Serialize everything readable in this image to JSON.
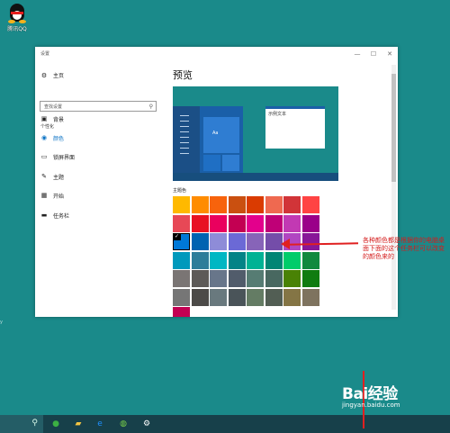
{
  "desktop": {
    "icon_label": "腾讯QQ",
    "edge_text": "y"
  },
  "window": {
    "title": "设置",
    "controls": {
      "minimize": "—",
      "maximize": "☐",
      "close": "✕"
    }
  },
  "sidebar": {
    "home": "主页",
    "search_placeholder": "查找设置",
    "section": "个性化",
    "items": [
      {
        "label": "背景",
        "icon": "picture-icon",
        "glyph": "▣"
      },
      {
        "label": "颜色",
        "icon": "palette-icon",
        "glyph": "◉",
        "active": true
      },
      {
        "label": "锁屏界面",
        "icon": "lock-screen-icon",
        "glyph": "▭"
      },
      {
        "label": "主题",
        "icon": "brush-icon",
        "glyph": "✎"
      },
      {
        "label": "开始",
        "icon": "start-icon",
        "glyph": "▦"
      },
      {
        "label": "任务栏",
        "icon": "taskbar-icon",
        "glyph": "▬"
      }
    ]
  },
  "main": {
    "heading": "预览",
    "preview_tile_text": "Aa",
    "preview_window_text": "示例文本",
    "swatch_label": "主题色",
    "selected_index": 16,
    "swatches": [
      "#ffb900",
      "#ff8c00",
      "#f7630c",
      "#ca5010",
      "#da3b01",
      "#ef6950",
      "#d13438",
      "#ff4343",
      "#e74856",
      "#e81123",
      "#ea005e",
      "#c30052",
      "#e3008c",
      "#bf0077",
      "#c239b3",
      "#9a0089",
      "#0078d7",
      "#0063b1",
      "#8e8cd8",
      "#6b69d6",
      "#8764b8",
      "#744da9",
      "#b146c2",
      "#881798",
      "#0099bc",
      "#2d7d9a",
      "#00b7c3",
      "#038387",
      "#00b294",
      "#018574",
      "#00cc6a",
      "#10893e",
      "#7a7574",
      "#5d5a58",
      "#68768a",
      "#515c6b",
      "#567c73",
      "#486860",
      "#498205",
      "#107c10",
      "#767676",
      "#4c4a48",
      "#69797e",
      "#4a5459",
      "#647c64",
      "#525e54",
      "#847545",
      "#7e735f",
      "#c30052"
    ]
  },
  "annotation": {
    "text": "各种颜色都是根据你的电脑桌面下面的这个任务栏可以改变的颜色来的",
    "color": "#e02020"
  },
  "taskbar": {
    "search_icon": "⚲",
    "icons": [
      {
        "name": "browser-icon",
        "glyph": "●",
        "color": "#3cb043"
      },
      {
        "name": "file-explorer-icon",
        "glyph": "▰",
        "color": "#f4c542"
      },
      {
        "name": "ie-browser-icon",
        "glyph": "e",
        "color": "#1e90ff"
      },
      {
        "name": "wechat-icon",
        "glyph": "◍",
        "color": "#7bd148"
      },
      {
        "name": "settings-gear-icon",
        "glyph": "⚙",
        "color": "#ffffff"
      }
    ]
  },
  "watermark": {
    "main": "Bai经验",
    "sub": "jingyan.baidu.com"
  }
}
